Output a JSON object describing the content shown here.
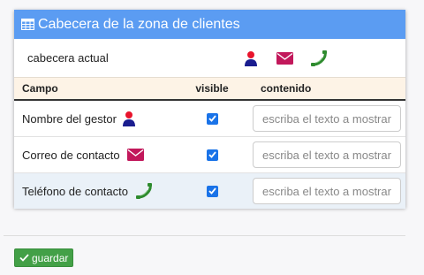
{
  "panel": {
    "title": "Cabecera de la zona de clientes",
    "current_label": "cabecera actual"
  },
  "table": {
    "headers": {
      "field": "Campo",
      "visible": "visible",
      "content": "contenido"
    },
    "rows": [
      {
        "label": "Nombre del gestor",
        "icon": "person-icon",
        "visible": true,
        "placeholder": "escriba el texto a mostrar"
      },
      {
        "label": "Correo de contacto",
        "icon": "envelope-icon",
        "visible": true,
        "placeholder": "escriba el texto a mostrar"
      },
      {
        "label": "Teléfono de contacto",
        "icon": "phone-icon",
        "visible": true,
        "placeholder": "escriba el texto a mostrar"
      }
    ]
  },
  "actions": {
    "save_label": "guardar"
  },
  "colors": {
    "header_bg": "#5b9cf2",
    "person_head": "#e8142c",
    "person_body": "#1a1d8f",
    "envelope": "#c2185b",
    "phone": "#2e8b2e",
    "checkbox": "#1a73e8",
    "save_button": "#43a047"
  }
}
